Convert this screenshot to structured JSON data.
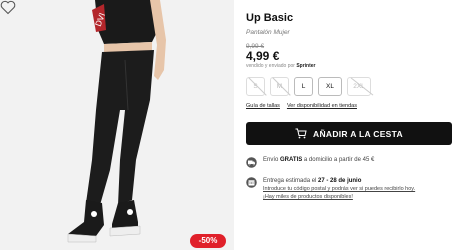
{
  "product": {
    "title": "Up Basic",
    "subtitle": "Pantalón Mujer",
    "old_price": "9,99 €",
    "price": "4,99 €",
    "seller_prefix": "vendido y enviado por",
    "seller_name": "Sprinter",
    "discount_badge": "-50%"
  },
  "sizes": [
    {
      "label": "S",
      "available": false
    },
    {
      "label": "M",
      "available": false
    },
    {
      "label": "L",
      "available": true
    },
    {
      "label": "XL",
      "available": true
    },
    {
      "label": "2XL",
      "available": false
    }
  ],
  "links": {
    "size_guide": "Guía de tallas",
    "store_availability": "Ver disponibilidad en tiendas"
  },
  "cart": {
    "label": "AÑADIR A LA CESTA",
    "icon": "cart-icon"
  },
  "shipping": {
    "prefix": "Envío",
    "highlight": "GRATIS",
    "suffix": "a domicilio a partir de 45 €",
    "icon": "truck-icon"
  },
  "delivery": {
    "prefix": "Entrega estimada el",
    "dates": "27 - 28 de junio",
    "link1": "Introduce tu código postal y podrás ver si puedes recibirlo hoy.",
    "link2": "¡Hay miles de productos disponibles!",
    "icon": "calendar-icon"
  },
  "colors": {
    "accent": "#111111",
    "discount": "#e0202a"
  }
}
